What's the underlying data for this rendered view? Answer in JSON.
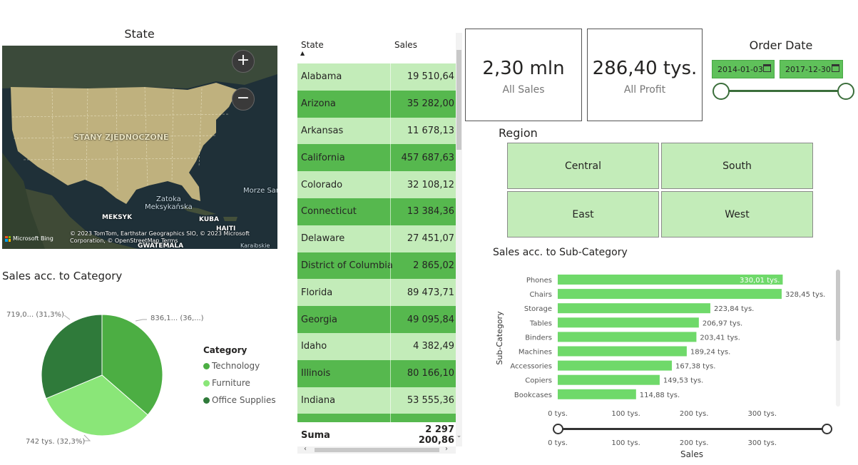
{
  "map": {
    "title": "State",
    "labels": {
      "usa": "STANY ZJEDNOCZONE",
      "gulf_line1": "Zatoka",
      "gulf_line2": "Meksykańska",
      "mexico": "MEKSYK",
      "cuba": "KUBA",
      "haiti": "HAITI",
      "guatemala": "GWATEMALA",
      "sargasso": "Morze Sarg",
      "caribbean": "Karaibskie"
    },
    "zoom_in": "+",
    "zoom_out": "−",
    "copyright": "© 2023 TomTom, Earthstar Geographics SIO, © 2023 Microsoft Corporation, © OpenStreetMap",
    "terms": "Terms",
    "bing": "Microsoft Bing"
  },
  "category_chart": {
    "title": "Sales acc. to Category",
    "legend_title": "Category",
    "colors": {
      "Technology": "#4cae43",
      "Furniture": "#8ae678",
      "Office Supplies": "#2f7a3a"
    },
    "labels": {
      "Technology": "836,1... (36,...)",
      "Furniture": "742 tys. (32,3%)",
      "Office Supplies": "719,0... (31,3%)"
    }
  },
  "table": {
    "col_state": "State",
    "col_sales": "Sales",
    "sort_icon": "▲",
    "rows": [
      {
        "state": "Alabama",
        "sales": "19 510,64"
      },
      {
        "state": "Arizona",
        "sales": "35 282,00"
      },
      {
        "state": "Arkansas",
        "sales": "11 678,13"
      },
      {
        "state": "California",
        "sales": "457 687,63"
      },
      {
        "state": "Colorado",
        "sales": "32 108,12"
      },
      {
        "state": "Connecticut",
        "sales": "13 384,36"
      },
      {
        "state": "Delaware",
        "sales": "27 451,07"
      },
      {
        "state": "District of Columbia",
        "sales": "2 865,02"
      },
      {
        "state": "Florida",
        "sales": "89 473,71"
      },
      {
        "state": "Georgia",
        "sales": "49 095,84"
      },
      {
        "state": "Idaho",
        "sales": "4 382,49"
      },
      {
        "state": "Illinois",
        "sales": "80 166,10"
      },
      {
        "state": "Indiana",
        "sales": "53 555,36"
      },
      {
        "state": "",
        "sales": ""
      }
    ],
    "total_label": "Suma",
    "total_value": "2 297 200,86"
  },
  "cards": {
    "sales_value": "2,30 mln",
    "sales_label": "All Sales",
    "profit_value": "286,40 tys.",
    "profit_label": "All Profit"
  },
  "order_date": {
    "title": "Order Date",
    "start": "2014-01-03",
    "end": "2017-12-30"
  },
  "region": {
    "title": "Region",
    "options": [
      "Central",
      "South",
      "East",
      "West"
    ]
  },
  "chart_data": {
    "type": "bar",
    "orientation": "horizontal",
    "title": "Sales acc. to Sub-Category",
    "xlabel": "Sales",
    "ylabel": "Sub-Category",
    "categories": [
      "Phones",
      "Chairs",
      "Storage",
      "Tables",
      "Binders",
      "Machines",
      "Accessories",
      "Copiers",
      "Bookcases"
    ],
    "values": [
      330.01,
      328.45,
      223.84,
      206.97,
      203.41,
      189.24,
      167.38,
      149.53,
      114.88
    ],
    "value_labels": [
      "330,01 tys.",
      "328,45 tys.",
      "223,84 tys.",
      "206,97 tys.",
      "203,41 tys.",
      "189,24 tys.",
      "167,38 tys.",
      "149,53 tys.",
      "114,88 tys."
    ],
    "xticks": [
      "0 tys.",
      "100 tys.",
      "200 tys.",
      "300 tys."
    ],
    "xtick_values": [
      0,
      100,
      200,
      300
    ],
    "xlim": [
      0,
      340
    ],
    "bar_color": "#6fd96a"
  }
}
